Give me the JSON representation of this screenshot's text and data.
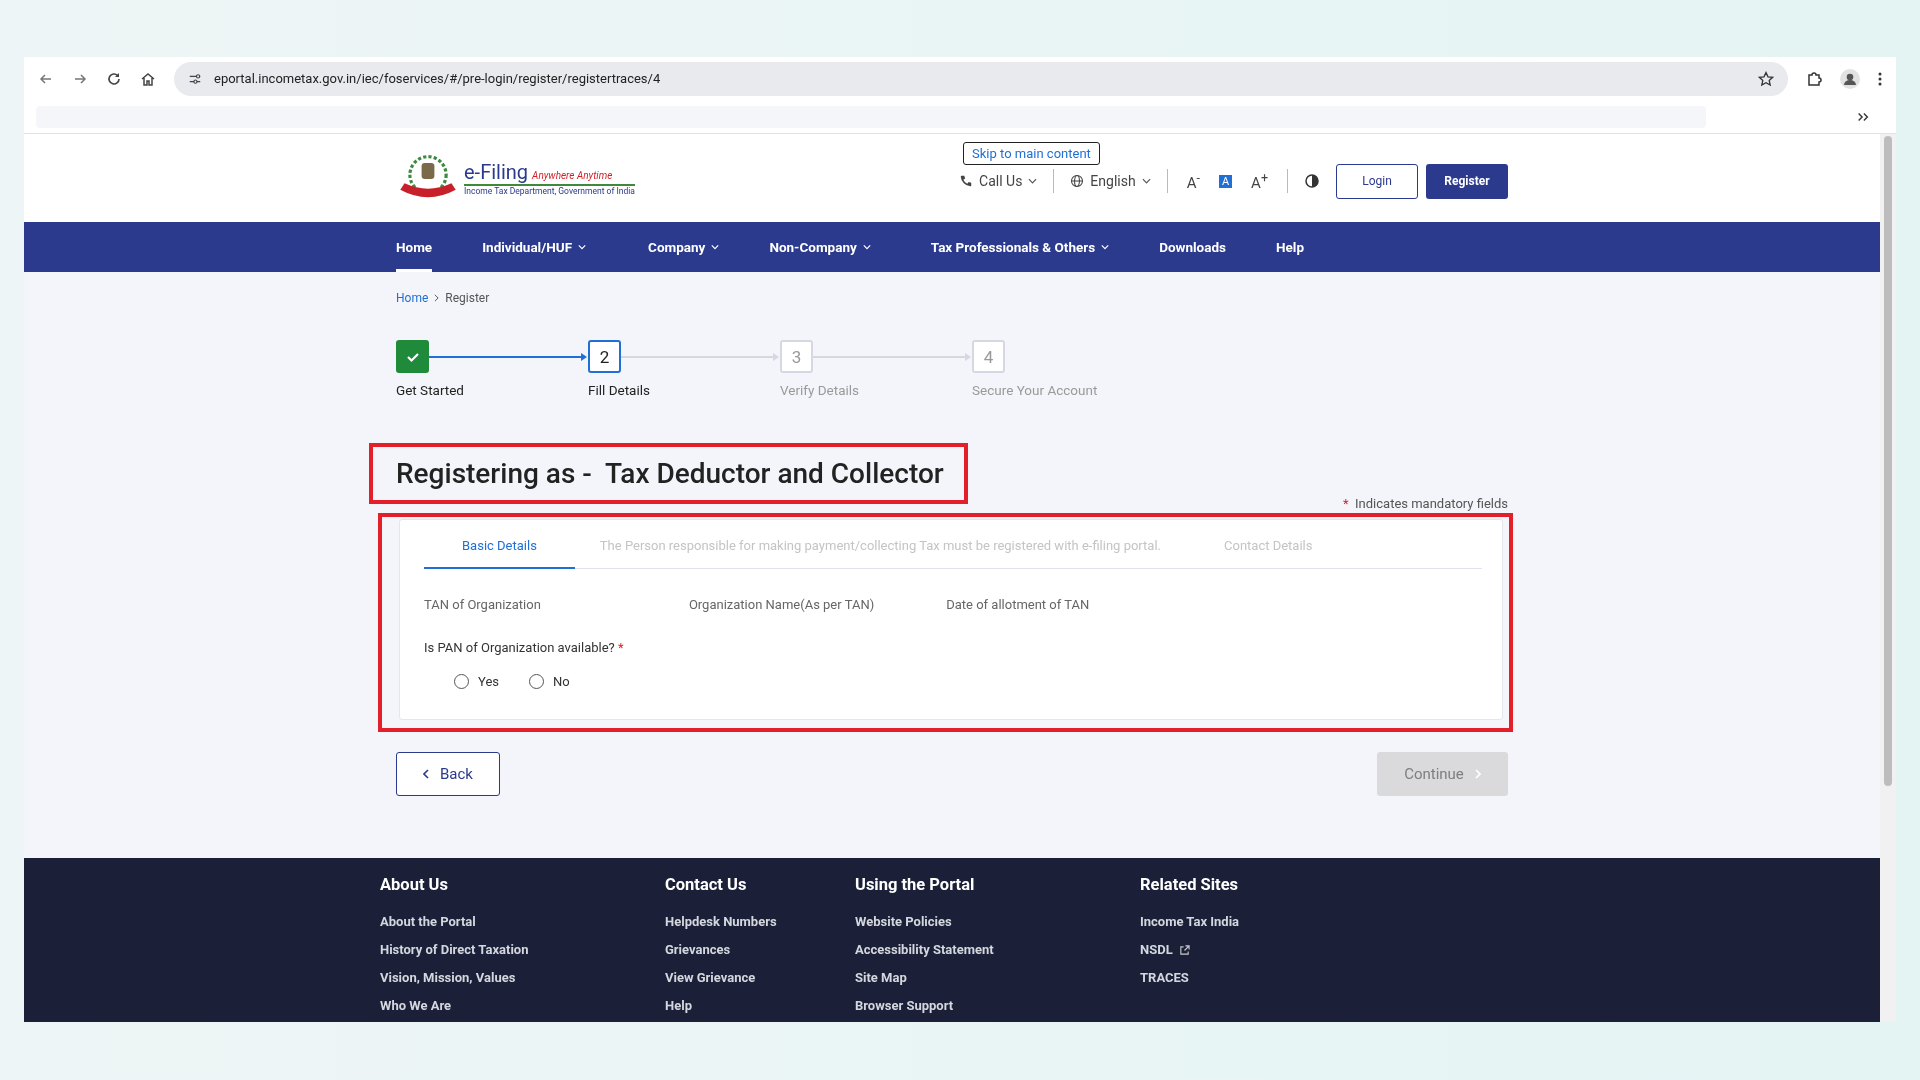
{
  "browser": {
    "url": "eportal.incometax.gov.in/iec/foservices/#/pre-login/register/registertraces/4"
  },
  "header": {
    "logo": {
      "title": "e-Filing",
      "tagline": "Anywhere Anytime",
      "subtitle": "Income Tax Department, Government of India"
    },
    "skip_link": "Skip to main content",
    "call_us": "Call Us",
    "language": "English",
    "font_controls": [
      {
        "label": "A$^{-}$",
        "selected": false
      },
      {
        "label": "A",
        "selected": true
      },
      {
        "label": "A$^{+}$",
        "selected": false
      }
    ],
    "login": "Login",
    "register": "Register"
  },
  "nav": [
    {
      "label": "Home",
      "selected": true,
      "dropdown": false
    },
    {
      "label": "Individual/HUF",
      "selected": false,
      "dropdown": true
    },
    {
      "label": "Company",
      "selected": false,
      "dropdown": true
    },
    {
      "label": "Non-Company",
      "selected": false,
      "dropdown": true
    },
    {
      "label": "Tax Professionals & Others",
      "selected": false,
      "dropdown": true
    },
    {
      "label": "Downloads",
      "selected": false,
      "dropdown": false
    },
    {
      "label": "Help",
      "selected": false,
      "dropdown": false
    }
  ],
  "breadcrumb": [
    "Home",
    "Register"
  ],
  "steps": [
    {
      "label": "Get Started",
      "done": true,
      "selected": false
    },
    {
      "number": "2",
      "label": "Fill Details",
      "done": false,
      "selected": true
    },
    {
      "number": "3",
      "label": "Verify Details",
      "done": false,
      "selected": false
    },
    {
      "number": "4",
      "label": "Secure Your Account",
      "done": false,
      "selected": false
    }
  ],
  "title": "Registering as -  Tax Deductor and Collector",
  "mandatory_note": {
    "mark": "*",
    "text": "Indicates mandatory fields"
  },
  "tabs": [
    {
      "label": "Basic Details",
      "selected": true
    },
    {
      "label": "The Person responsible for making payment/collecting Tax must be registered with e-filing portal.",
      "selected": false
    },
    {
      "label": "Contact Details",
      "selected": false
    }
  ],
  "fields": [
    "TAN of Organization",
    "Organization Name(As per TAN)",
    "Date of allotment of TAN"
  ],
  "question": {
    "label": "Is PAN of Organization available?",
    "mark": "*"
  },
  "options": [
    {
      "label": "Yes",
      "selected": false
    },
    {
      "label": "No",
      "selected": false
    }
  ],
  "back_button": "Back",
  "continue_button": {
    "label": "Continue",
    "disabled": true
  },
  "footer": [
    {
      "heading": "About Us",
      "links": [
        {
          "label": "About the Portal",
          "external": false
        },
        {
          "label": "History of Direct Taxation",
          "external": false
        },
        {
          "label": "Vision, Mission, Values",
          "external": false
        },
        {
          "label": "Who We Are",
          "external": false
        }
      ]
    },
    {
      "heading": "Contact Us",
      "links": [
        {
          "label": "Helpdesk Numbers",
          "external": false
        },
        {
          "label": "Grievances",
          "external": false
        },
        {
          "label": "View Grievance",
          "external": false
        },
        {
          "label": "Help",
          "external": false
        }
      ]
    },
    {
      "heading": "Using the Portal",
      "links": [
        {
          "label": "Website Policies",
          "external": false
        },
        {
          "label": "Accessibility Statement",
          "external": false
        },
        {
          "label": "Site Map",
          "external": false
        },
        {
          "label": "Browser Support",
          "external": false
        }
      ]
    },
    {
      "heading": "Related Sites",
      "links": [
        {
          "label": "Income Tax India",
          "external": false
        },
        {
          "label": "NSDL",
          "external": true
        },
        {
          "label": "TRACES",
          "external": false
        }
      ]
    }
  ]
}
